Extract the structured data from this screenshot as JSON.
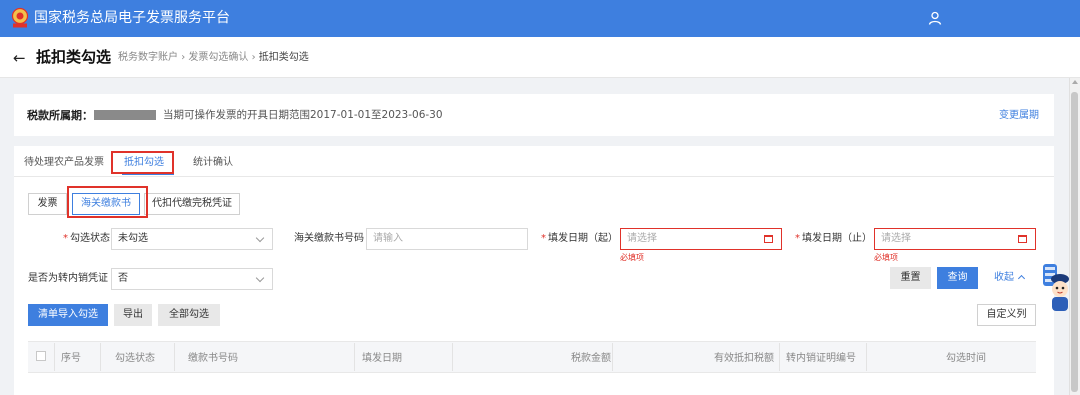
{
  "header": {
    "app_title": "国家税务总局电子发票服务平台",
    "emblem_caption": "Tax"
  },
  "page": {
    "back_label": "←",
    "title": "抵扣类勾选",
    "breadcrumb": {
      "sep1": "›",
      "sep2": "›",
      "items": [
        "税务数字账户",
        "发票勾选确认",
        "抵扣类勾选"
      ]
    }
  },
  "period": {
    "label": "税款所属期：",
    "info": "当期可操作发票的开具日期范围2017-01-01至2023-06-30",
    "change_link": "变更属期"
  },
  "tabs": [
    {
      "label": "待处理农产品发票"
    },
    {
      "label": "抵扣勾选"
    },
    {
      "label": "统计确认"
    }
  ],
  "segments": [
    {
      "label": "发票"
    },
    {
      "label": "海关缴款书"
    },
    {
      "label": "代扣代缴完税凭证"
    }
  ],
  "form": {
    "required_mark": "*",
    "status_label": "勾选状态",
    "status_value": "未勾选",
    "number_label": "海关缴款书号码",
    "number_placeholder": "请输入",
    "date_start_label": "填发日期（起）",
    "date_start_placeholder": "请选择",
    "date_start_error": "必填项",
    "date_end_label": "填发日期（止）",
    "date_end_placeholder": "请选择",
    "date_end_error": "必填项",
    "transfer_label": "是否为转内销凭证",
    "transfer_value": "否"
  },
  "actions": {
    "reset": "重置",
    "query": "查询",
    "collapse": "收起",
    "import_select": "清单导入勾选",
    "export": "导出",
    "select_all": "全部勾选",
    "customize": "自定义列"
  },
  "table": {
    "columns": [
      "序号",
      "勾选状态",
      "缴款书号码",
      "填发日期",
      "税款金额",
      "有效抵扣税额",
      "转内销证明编号",
      "勾选时间"
    ]
  },
  "colors": {
    "primary": "#3e7fdf",
    "highlight_red": "#e0322a"
  }
}
